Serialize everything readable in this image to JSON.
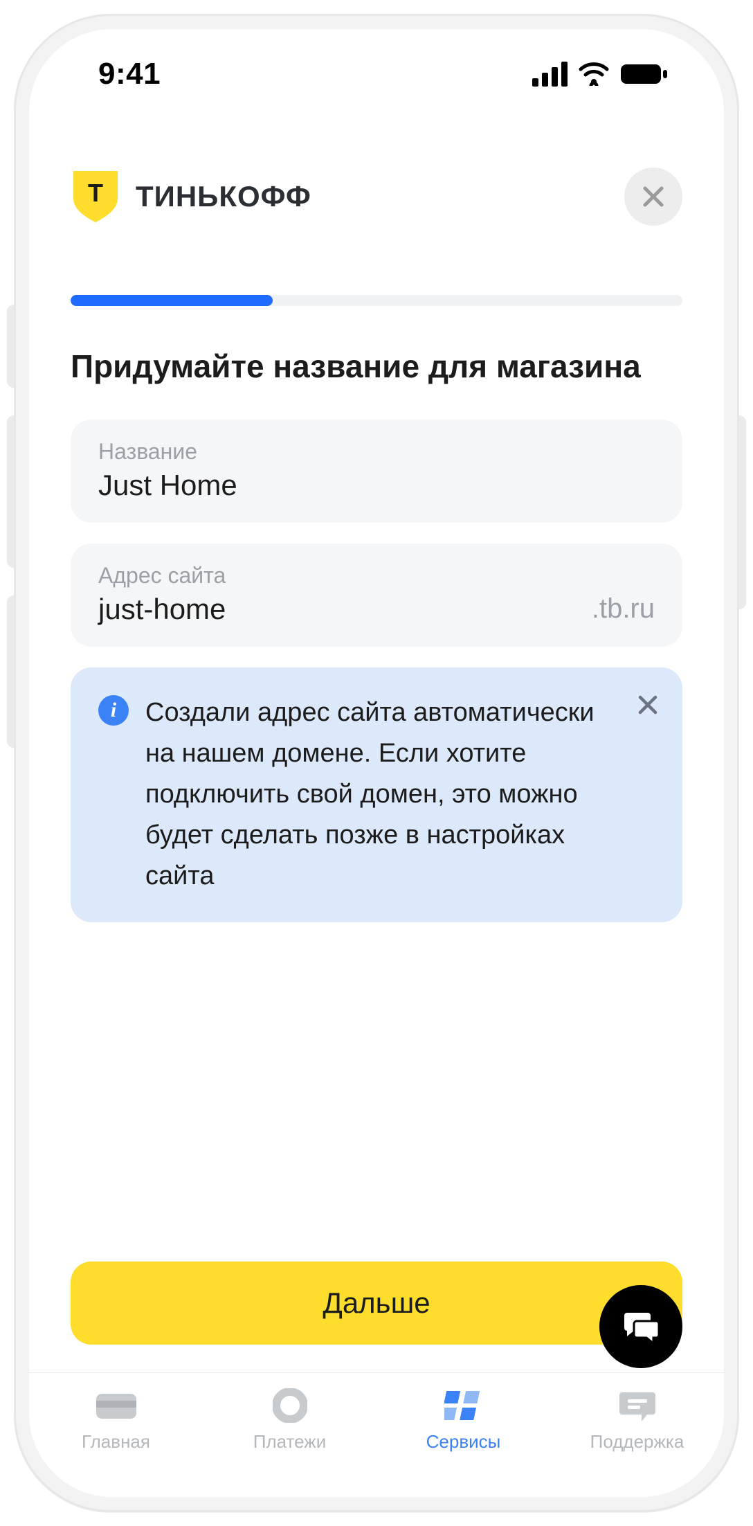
{
  "statusbar": {
    "time": "9:41"
  },
  "header": {
    "brand": "ТИНЬКОФФ"
  },
  "progress": {
    "percent": 33
  },
  "heading": "Придумайте название для магазина",
  "fields": {
    "name": {
      "label": "Название",
      "value": "Just Home"
    },
    "address": {
      "label": "Адрес сайта",
      "value": "just-home",
      "suffix": ".tb.ru"
    }
  },
  "info": {
    "text": "Создали адрес сайта автоматически на нашем домене. Если хотите подключить свой домен, это можно будет сделать позже в настройках сайта"
  },
  "footer": {
    "primary": "Дальше"
  },
  "tabs": [
    {
      "label": "Главная"
    },
    {
      "label": "Платежи"
    },
    {
      "label": "Сервисы",
      "active": true
    },
    {
      "label": "Поддержка"
    }
  ]
}
